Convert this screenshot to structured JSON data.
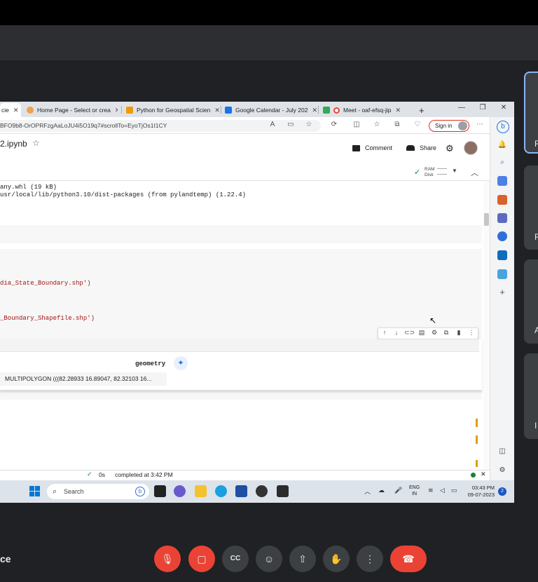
{
  "browser": {
    "tabs": [
      {
        "label": "cie",
        "close": "✕"
      },
      {
        "label": "Home Page - Select or crea",
        "close": "✕"
      },
      {
        "label": "Python for Geospatial Scien",
        "close": "✕"
      },
      {
        "label": "Google Calendar - July 202",
        "close": "✕"
      },
      {
        "label": "Meet - oaf-efsq-jip",
        "close": "✕"
      }
    ],
    "new_tab": "+",
    "url": "BFO9b8-OrOPRFzgAaLoJU4i5O19q7#scrollTo=EyoTjOs1I1CY",
    "signin_label": "Sign in"
  },
  "colab": {
    "notebook_title": "2.ipynb",
    "comment_label": "Comment",
    "share_label": "Share",
    "ram_label": "RAM",
    "disk_label": "Disk",
    "output_lines": [
      "any.whl (19 kB)",
      "usr/local/lib/python3.10/dist-packages (from pylandtemp) (1.22.4)"
    ],
    "code_line_1": "dia_State_Boundary.shp')",
    "code_line_2": "_Boundary_Shapefile.shp')",
    "geometry_header": "geometry",
    "geometry_value": "MULTIPOLYGON (((82.28933 16.89047, 82.32103 16...",
    "status_time": "0s",
    "status_text": "completed at 3:42 PM"
  },
  "taskbar": {
    "search_placeholder": "Search",
    "lang_line1": "ENG",
    "lang_line2": "IN",
    "time": "03:43 PM",
    "date": "09-07-2023",
    "notification_count": "2"
  },
  "participants": [
    "R",
    "R",
    "A",
    "I"
  ],
  "meet": {
    "meeting_code_fragment": "ce"
  },
  "colors": {
    "end_call": "#ea4335",
    "meet_bg": "#202124",
    "tile_bg": "#3c4043"
  }
}
